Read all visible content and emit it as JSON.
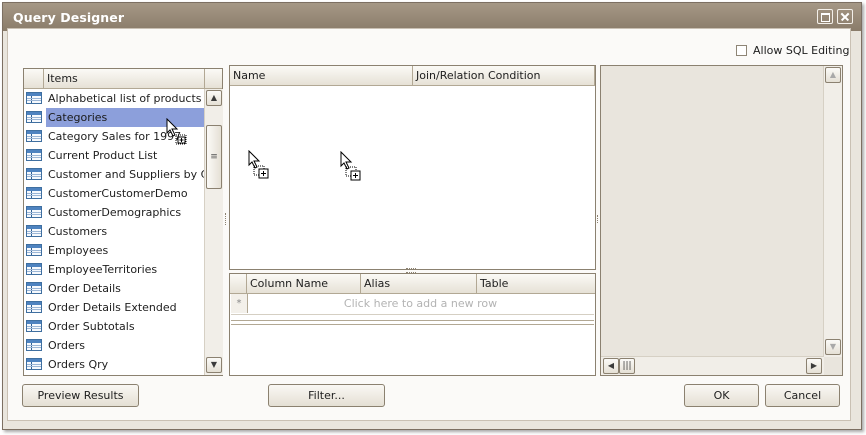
{
  "window": {
    "title": "Query Designer"
  },
  "options": {
    "allow_sql_editing_label": "Allow SQL Editing",
    "allow_sql_editing_checked": false
  },
  "items_panel": {
    "header": "Items",
    "items": [
      "Alphabetical list of products",
      "Categories",
      "Category Sales for 1997",
      "Current Product List",
      "Customer and Suppliers by City",
      "CustomerCustomerDemo",
      "CustomerDemographics",
      "Customers",
      "Employees",
      "EmployeeTerritories",
      "Order Details",
      "Order Details Extended",
      "Order Subtotals",
      "Orders",
      "Orders Qry"
    ],
    "selected_index": 1
  },
  "tables_grid": {
    "columns": [
      "Name",
      "Join/Relation Condition"
    ]
  },
  "columns_grid": {
    "columns": [
      "Column Name",
      "Alias",
      "Table"
    ],
    "new_row_indicator": "*",
    "new_row_placeholder": "Click here to add a new row"
  },
  "buttons": {
    "preview_results": "Preview Results",
    "filter": "Filter...",
    "ok": "OK",
    "cancel": "Cancel"
  },
  "icons": {
    "table_icon": "table-icon",
    "drag_cursor": "drag-copy-cursor-icon"
  }
}
